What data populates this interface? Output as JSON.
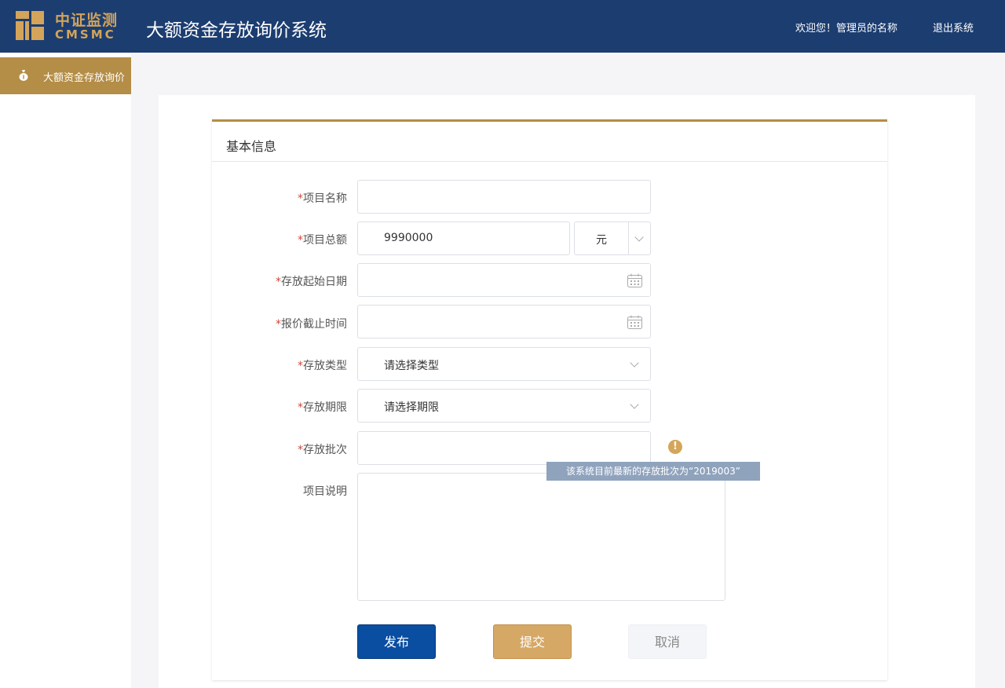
{
  "header": {
    "logo_cn": "中证监测",
    "logo_en": "CMSMC",
    "app_title": "大额资金存放询价系统",
    "welcome": "欢迎您！管理员的名称",
    "logout_label": "退出系统",
    "bg_color": "#1c3d70",
    "accent_color": "#d3a45a"
  },
  "sidebar": {
    "items": [
      {
        "label": "大额资金存放询价",
        "icon": "money-bag-icon",
        "active": true
      }
    ]
  },
  "form": {
    "section_title": "基本信息",
    "required_mark": "*",
    "fields": {
      "project_name": {
        "label": "项目名称",
        "value": ""
      },
      "project_amount": {
        "label": "项目总额",
        "value": "9990000",
        "unit": "元"
      },
      "start_date": {
        "label": "存放起始日期",
        "value": ""
      },
      "quote_deadline": {
        "label": "报价截止时间",
        "value": ""
      },
      "deposit_type": {
        "label": "存放类型",
        "placeholder": "请选择类型"
      },
      "deposit_term": {
        "label": "存放期限",
        "placeholder": "请选择期限"
      },
      "deposit_batch": {
        "label": "存放批次",
        "value": "",
        "hint": "该系统目前最新的存放批次为“2019003”"
      },
      "description": {
        "label": "项目说明",
        "value": ""
      }
    }
  },
  "actions": {
    "publish_label": "发布",
    "submit_label": "提交",
    "cancel_label": "取消"
  }
}
